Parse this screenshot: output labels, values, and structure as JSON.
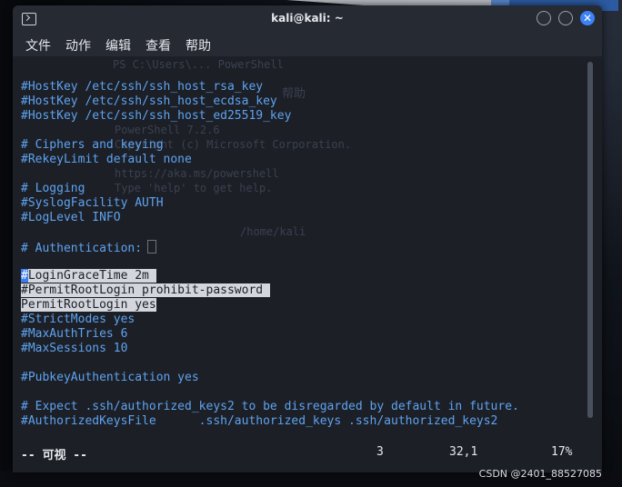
{
  "window": {
    "title": "kali@kali: ~",
    "close_glyph": "✕"
  },
  "menu": [
    "文件",
    "动作",
    "编辑",
    "查看",
    "帮助"
  ],
  "background_ghost": [
    "PS C:\\Users\\... PowerShell",
    "帮助",
    "PowerShell 7.2.6",
    "Copyright (c) Microsoft Corporation.",
    "https://aka.ms/powershell",
    "Type 'help' to get help.",
    "/home/kali"
  ],
  "lines": [
    {
      "text": "#HostKey /etc/ssh/ssh_host_rsa_key"
    },
    {
      "text": "#HostKey /etc/ssh/ssh_host_ecdsa_key"
    },
    {
      "text": "#HostKey /etc/ssh/ssh_host_ed25519_key"
    },
    {
      "text": ""
    },
    {
      "text": "# Ciphers and keying"
    },
    {
      "text": "#RekeyLimit default none"
    },
    {
      "text": ""
    },
    {
      "text": "# Logging"
    },
    {
      "text": "#SyslogFacility AUTH"
    },
    {
      "text": "#LogLevel INFO"
    },
    {
      "text": ""
    },
    {
      "text": "# Authentication:"
    },
    {
      "text": ""
    },
    {
      "cursor_char": "#",
      "rest": "LoginGraceTime 2m "
    },
    {
      "text": "#PermitRootLogin prohibit-password "
    },
    {
      "text": "PermitRootLogin yes"
    },
    {
      "text": "#StrictModes yes"
    },
    {
      "text": "#MaxAuthTries 6"
    },
    {
      "text": "#MaxSessions 10"
    },
    {
      "text": ""
    },
    {
      "text": "#PubkeyAuthentication yes"
    },
    {
      "text": ""
    },
    {
      "text": "# Expect .ssh/authorized_keys2 to be disregarded by default in future."
    },
    {
      "text": "#AuthorizedKeysFile      .ssh/authorized_keys .ssh/authorized_keys2"
    }
  ],
  "status": {
    "mode": "-- 可视 --",
    "count": "3",
    "position": "32,1",
    "percent": "17%"
  },
  "watermark": "CSDN @2401_88527085",
  "colors": {
    "accent": "#3b82f6",
    "syntax_comment": "#5ea3f0",
    "selection": "#d3d6dc"
  }
}
